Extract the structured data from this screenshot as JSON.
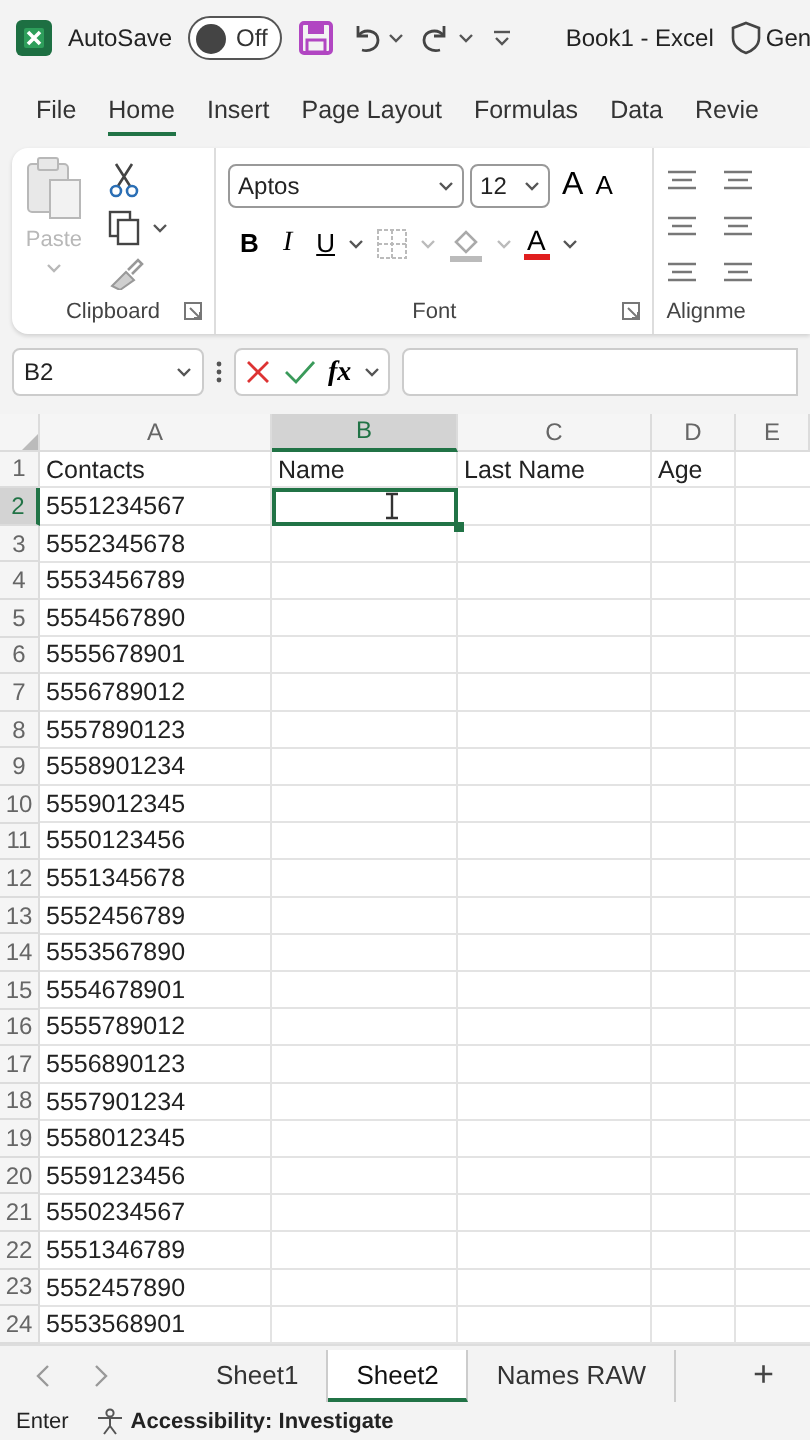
{
  "title_bar": {
    "autosave_label": "AutoSave",
    "autosave": {
      "on": false,
      "label": "Off"
    },
    "title": "Book1 - Excel",
    "search_partial": "Gen"
  },
  "menu_tabs": [
    {
      "label": "File",
      "selected": false
    },
    {
      "label": "Home",
      "selected": true
    },
    {
      "label": "Insert",
      "selected": false
    },
    {
      "label": "Page Layout",
      "selected": false
    },
    {
      "label": "Formulas",
      "selected": false
    },
    {
      "label": "Data",
      "selected": false
    },
    {
      "label": "Revie",
      "selected": false
    }
  ],
  "ribbon": {
    "groups": [
      {
        "kind": "clipboard",
        "label": "Clipboard",
        "paste": {
          "label": "Paste",
          "disabled": true
        }
      },
      {
        "kind": "font",
        "label": "Font",
        "font_name": "Aptos",
        "font_size": "12",
        "grow_label": "A",
        "shrink_label": "A",
        "bold_label": "B",
        "italic_label": "I",
        "underline_label": "U",
        "font_color_label": "A"
      },
      {
        "kind": "alignment",
        "label": "Alignme"
      }
    ]
  },
  "formula_bar": {
    "name_box": "B2",
    "function_label": "fx"
  },
  "columns": [
    {
      "label": "A",
      "selected": false
    },
    {
      "label": "B",
      "selected": true
    },
    {
      "label": "C",
      "selected": false
    },
    {
      "label": "D",
      "selected": false
    },
    {
      "label": "E",
      "selected": false
    }
  ],
  "rows": [
    {
      "number": "1",
      "selected": false,
      "cells": [
        {
          "text": "Contacts",
          "selected": false
        },
        {
          "text": "Name",
          "selected": false
        },
        {
          "text": "Last Name",
          "selected": false
        },
        {
          "text": "Age",
          "selected": false
        }
      ]
    },
    {
      "number": "2",
      "selected": true,
      "cells": [
        {
          "text": "5551234567",
          "selected": false
        },
        {
          "selected": true
        }
      ]
    },
    {
      "number": "3",
      "selected": false,
      "cells": [
        {
          "text": "5552345678",
          "selected": false
        }
      ]
    },
    {
      "number": "4",
      "selected": false,
      "cells": [
        {
          "text": "5553456789",
          "selected": false
        }
      ]
    },
    {
      "number": "5",
      "selected": false,
      "cells": [
        {
          "text": "5554567890",
          "selected": false
        }
      ]
    },
    {
      "number": "6",
      "selected": false,
      "cells": [
        {
          "text": "5555678901",
          "selected": false
        }
      ]
    },
    {
      "number": "7",
      "selected": false,
      "cells": [
        {
          "text": "5556789012",
          "selected": false
        }
      ]
    },
    {
      "number": "8",
      "selected": false,
      "cells": [
        {
          "text": "5557890123",
          "selected": false
        }
      ]
    },
    {
      "number": "9",
      "selected": false,
      "cells": [
        {
          "text": "5558901234",
          "selected": false
        }
      ]
    },
    {
      "number": "10",
      "selected": false,
      "cells": [
        {
          "text": "5559012345",
          "selected": false
        }
      ]
    },
    {
      "number": "11",
      "selected": false,
      "cells": [
        {
          "text": "5550123456",
          "selected": false
        }
      ]
    },
    {
      "number": "12",
      "selected": false,
      "cells": [
        {
          "text": "5551345678",
          "selected": false
        }
      ]
    },
    {
      "number": "13",
      "selected": false,
      "cells": [
        {
          "text": "5552456789",
          "selected": false
        }
      ]
    },
    {
      "number": "14",
      "selected": false,
      "cells": [
        {
          "text": "5553567890",
          "selected": false
        }
      ]
    },
    {
      "number": "15",
      "selected": false,
      "cells": [
        {
          "text": "5554678901",
          "selected": false
        }
      ]
    },
    {
      "number": "16",
      "selected": false,
      "cells": [
        {
          "text": "5555789012",
          "selected": false
        }
      ]
    },
    {
      "number": "17",
      "selected": false,
      "cells": [
        {
          "text": "5556890123",
          "selected": false
        }
      ]
    },
    {
      "number": "18",
      "selected": false,
      "cells": [
        {
          "text": "5557901234",
          "selected": false
        }
      ]
    },
    {
      "number": "19",
      "selected": false,
      "cells": [
        {
          "text": "5558012345",
          "selected": false
        }
      ]
    },
    {
      "number": "20",
      "selected": false,
      "cells": [
        {
          "text": "5559123456",
          "selected": false
        }
      ]
    },
    {
      "number": "21",
      "selected": false,
      "cells": [
        {
          "text": "5550234567",
          "selected": false
        }
      ]
    },
    {
      "number": "22",
      "selected": false,
      "cells": [
        {
          "text": "5551346789",
          "selected": false
        }
      ]
    },
    {
      "number": "23",
      "selected": false,
      "cells": [
        {
          "text": "5552457890",
          "selected": false
        }
      ]
    },
    {
      "number": "24",
      "selected": false,
      "cells": [
        {
          "text": "5553568901",
          "selected": false
        }
      ]
    }
  ],
  "sheet_tabs": [
    {
      "label": "Sheet1",
      "selected": false
    },
    {
      "label": "Sheet2",
      "selected": true
    },
    {
      "label": "Names RAW",
      "selected": false
    }
  ],
  "add_sheet_label": "+",
  "status_bar": {
    "mode": "Enter",
    "accessibility": "Accessibility: Investigate"
  }
}
